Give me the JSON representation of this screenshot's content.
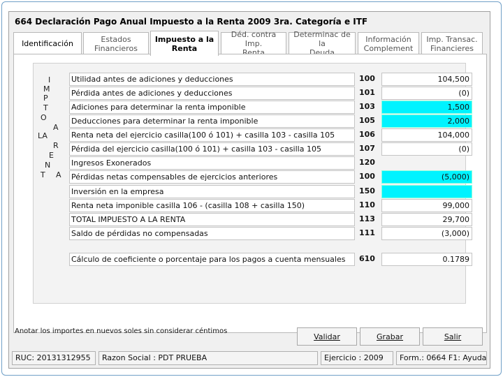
{
  "window": {
    "title": "664 Declaración Pago Anual Impuesto a la Renta 2009 3ra. Categoría e ITF"
  },
  "tabs": [
    {
      "label": "Identificación"
    },
    {
      "label": "Estados\nFinancieros"
    },
    {
      "label": "Impuesto a la\nRenta"
    },
    {
      "label": "Déd. contra Imp.\nRenta"
    },
    {
      "label": "Determinac de la\nDeuda"
    },
    {
      "label": "Información\nComplement"
    },
    {
      "label": "Imp. Transac.\nFinancieres"
    }
  ],
  "vertical_letters": [
    "I",
    "M",
    "P",
    "T",
    "O",
    "A",
    "LA",
    "R",
    "E",
    "N",
    "T",
    "A"
  ],
  "rows": [
    {
      "desc": "Utilidad antes de adiciones y deducciones",
      "code": "100",
      "amount": "104,500",
      "highlight": false
    },
    {
      "desc": "Pérdida antes de adiciones y deducciones",
      "code": "101",
      "amount": "(0)",
      "highlight": false
    },
    {
      "desc": "Adiciones para determinar la renta imponible",
      "code": "103",
      "amount": "1,500",
      "highlight": true
    },
    {
      "desc": "Deducciones para determinar la renta imponible",
      "code": "105",
      "amount": "2,000",
      "highlight": true
    },
    {
      "desc": "Renta neta del ejercicio       casilla(100 ó 101) + casilla 103 - casilla 105",
      "code": "106",
      "amount": "104,000",
      "highlight": false
    },
    {
      "desc": "Pérdida del ejercicio           casilla(100 ó 101) + casilla 103 - casilla 105",
      "code": "107",
      "amount": "(0)",
      "highlight": false
    },
    {
      "desc": "Ingresos Exonerados",
      "code": "120",
      "amount": "",
      "highlight": false
    },
    {
      "desc": "Pérdidas netas compensables de ejercicios anteriores",
      "code": "100",
      "amount": "(5,000)",
      "highlight": true
    },
    {
      "desc": "Inversión en la empresa",
      "code": "150",
      "amount": "",
      "highlight": true
    },
    {
      "desc": "Renta neta imponible          casilla 106 - (casilla 108 + casilla 150)",
      "code": "110",
      "amount": "99,000",
      "highlight": false
    },
    {
      "desc": "TOTAL IMPUESTO A LA RENTA",
      "code": "113",
      "amount": "29,700",
      "highlight": false
    },
    {
      "desc": "Saldo de pérdidas no compensadas",
      "code": "111",
      "amount": "(3,000)",
      "highlight": false
    },
    {
      "desc": "Cálculo de coeficiente o porcentaje para los pagos a cuenta mensuales",
      "code": "610",
      "amount": "0.1789",
      "highlight": false
    }
  ],
  "note": "Anotar los importes en nuevos soles sin considerar céntimos",
  "buttons": {
    "validar": "Validar",
    "grabar": "Grabar",
    "salir": "Salir"
  },
  "status": {
    "ruc": "RUC: 20131312955",
    "razon_social": "Razon Social : PDT PRUEBA",
    "ejercicio": "Ejercicio : 2009",
    "form": "Form.: 0664   F1: Ayuda"
  }
}
